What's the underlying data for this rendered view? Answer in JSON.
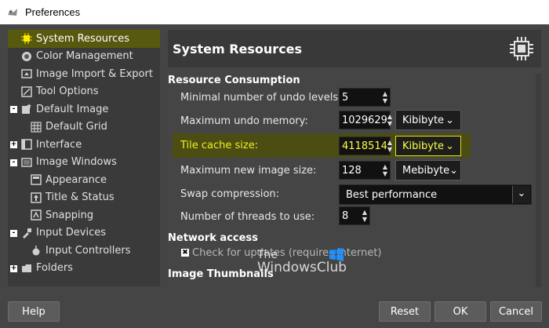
{
  "window": {
    "title": "Preferences"
  },
  "sidebar": {
    "items": [
      {
        "label": "System Resources",
        "icon": "chip-icon",
        "selected": true
      },
      {
        "label": "Color Management",
        "icon": "color-icon"
      },
      {
        "label": "Image Import & Export",
        "icon": "import-icon"
      },
      {
        "label": "Tool Options",
        "icon": "tool-options-icon"
      },
      {
        "label": "Default Image",
        "icon": "default-image-icon",
        "expander": "-"
      },
      {
        "label": "Default Grid",
        "icon": "grid-icon"
      },
      {
        "label": "Interface",
        "icon": "interface-icon",
        "expander": "+"
      },
      {
        "label": "Image Windows",
        "icon": "image-windows-icon",
        "expander": "-"
      },
      {
        "label": "Appearance",
        "icon": "appearance-icon"
      },
      {
        "label": "Title & Status",
        "icon": "title-status-icon"
      },
      {
        "label": "Snapping",
        "icon": "snapping-icon"
      },
      {
        "label": "Input Devices",
        "icon": "input-devices-icon",
        "expander": "-"
      },
      {
        "label": "Input Controllers",
        "icon": "input-controllers-icon"
      },
      {
        "label": "Folders",
        "icon": "folders-icon",
        "expander": "+"
      }
    ]
  },
  "main": {
    "header": "System Resources",
    "resource_section": "Resource Consumption",
    "undo_levels_label": "Minimal number of undo levels:",
    "undo_levels_value": "5",
    "undo_memory_label": "Maximum undo memory:",
    "undo_memory_value": "1029629",
    "undo_memory_unit": "Kibibyte",
    "tile_cache_label": "Tile cache size:",
    "tile_cache_value": "4118514",
    "tile_cache_unit": "Kibibyte",
    "max_image_label": "Maximum new image size:",
    "max_image_value": "128",
    "max_image_unit": "Mebibyte",
    "swap_label": "Swap compression:",
    "swap_value": "Best performance",
    "threads_label": "Number of threads to use:",
    "threads_value": "8",
    "network_section": "Network access",
    "check_updates_label": "Check for updates (requires internet)",
    "thumbnails_section": "Image Thumbnails"
  },
  "buttons": {
    "help": "Help",
    "reset": "Reset",
    "ok": "OK",
    "cancel": "Cancel"
  },
  "watermark": {
    "line1": "The",
    "line2": "WindowsClub"
  },
  "colors": {
    "selection": "#57590f",
    "highlight": "#4c4d12",
    "background": "#454545"
  }
}
